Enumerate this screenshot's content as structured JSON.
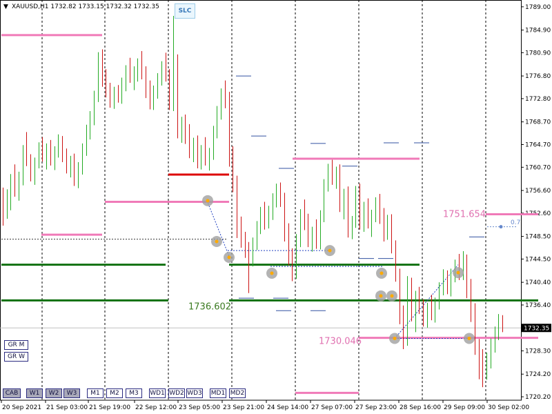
{
  "header": {
    "symbol": "XAUUSD,H1",
    "open": "1732.82",
    "high": "1733.15",
    "low": "1732.32",
    "close": "1732.35",
    "arrow_icon": "triangle-down-icon"
  },
  "slc_button": {
    "label": "SLC"
  },
  "left_buttons": [
    {
      "id": "grm",
      "label": "GR M"
    },
    {
      "id": "grw",
      "label": "GR W"
    }
  ],
  "bottom_buttons": [
    {
      "label": "CAB",
      "dark": true
    },
    {
      "label": "W1",
      "dark": true
    },
    {
      "label": "W2",
      "dark": true
    },
    {
      "label": "W3",
      "dark": true
    },
    {
      "label": "M1",
      "dark": false
    },
    {
      "label": "M2",
      "dark": false
    },
    {
      "label": "M3",
      "dark": false
    },
    {
      "label": "WD1",
      "dark": false
    },
    {
      "label": "WD2",
      "dark": false
    },
    {
      "label": "WD3",
      "dark": false
    },
    {
      "label": "MD1",
      "dark": false
    },
    {
      "label": "MD2",
      "dark": false
    }
  ],
  "chart_data": {
    "type": "candlestick",
    "symbol": "XAUUSD",
    "timeframe": "H1",
    "price_axis": {
      "ticks": [
        "1789.00",
        "1784.90",
        "1780.90",
        "1776.80",
        "1772.80",
        "1768.70",
        "1764.70",
        "1760.70",
        "1756.60",
        "1752.60",
        "1748.50",
        "1744.50",
        "1740.40",
        "1736.40",
        "1732.35",
        "1728.30",
        "1724.20",
        "1720.20"
      ],
      "range": [
        1719.6,
        1790.2
      ],
      "current_price": "1732.35"
    },
    "time_axis": {
      "labels": [
        "20 Sep 2021",
        "21 Sep 03:00",
        "21 Sep 19:00",
        "22 Sep 12:00",
        "23 Sep 05:00",
        "23 Sep 21:00",
        "24 Sep 14:00",
        "27 Sep 07:00",
        "27 Sep 23:00",
        "28 Sep 16:00",
        "29 Sep 09:00",
        "30 Sep 02:00"
      ]
    },
    "annotations": [
      {
        "text": "1736.602",
        "color": "#3a7a20"
      },
      {
        "text": "1730.046",
        "color": "#e070b0"
      },
      {
        "text": "1751.654",
        "color": "#e070b0"
      },
      {
        "text": "0.7",
        "color": "#6688cc"
      }
    ],
    "candles": [
      [
        1755.2,
        1757.1,
        1750.4,
        1752.9
      ],
      [
        1752.9,
        1756.8,
        1751.6,
        1754.2
      ],
      [
        1754.2,
        1759.5,
        1753.1,
        1758.7
      ],
      [
        1758.7,
        1761.2,
        1755.5,
        1756.1
      ],
      [
        1756.1,
        1759.9,
        1754.8,
        1759.3
      ],
      [
        1759.3,
        1764.6,
        1757.5,
        1763.8
      ],
      [
        1763.8,
        1766.9,
        1760.9,
        1761.4
      ],
      [
        1761.4,
        1763.0,
        1758.2,
        1759.0
      ],
      [
        1759.0,
        1762.4,
        1757.6,
        1761.8
      ],
      [
        1761.8,
        1765.1,
        1760.5,
        1764.3
      ],
      [
        1764.3,
        1766.0,
        1761.7,
        1762.5
      ],
      [
        1762.5,
        1764.9,
        1760.3,
        1763.9
      ],
      [
        1763.9,
        1765.5,
        1761.0,
        1762.0
      ],
      [
        1762.0,
        1764.4,
        1760.2,
        1763.6
      ],
      [
        1763.6,
        1766.5,
        1762.4,
        1765.4
      ],
      [
        1765.4,
        1766.2,
        1761.6,
        1762.8
      ],
      [
        1762.8,
        1764.0,
        1759.6,
        1760.5
      ],
      [
        1760.5,
        1762.7,
        1758.9,
        1761.9
      ],
      [
        1761.9,
        1763.1,
        1757.4,
        1758.3
      ],
      [
        1758.3,
        1761.6,
        1757.0,
        1760.8
      ],
      [
        1760.8,
        1764.9,
        1759.4,
        1764.1
      ],
      [
        1764.1,
        1768.2,
        1762.7,
        1767.3
      ],
      [
        1767.3,
        1770.6,
        1765.6,
        1769.4
      ],
      [
        1769.4,
        1774.2,
        1768.1,
        1773.5
      ],
      [
        1773.5,
        1781.0,
        1772.2,
        1779.8
      ],
      [
        1779.8,
        1781.5,
        1774.9,
        1776.2
      ],
      [
        1776.2,
        1778.0,
        1773.0,
        1774.1
      ],
      [
        1774.1,
        1775.6,
        1771.2,
        1772.4
      ],
      [
        1772.4,
        1774.9,
        1771.0,
        1773.8
      ],
      [
        1773.8,
        1775.2,
        1772.1,
        1772.9
      ],
      [
        1772.9,
        1776.5,
        1771.9,
        1775.7
      ],
      [
        1775.7,
        1778.7,
        1774.1,
        1777.9
      ],
      [
        1777.9,
        1780.0,
        1775.6,
        1776.4
      ],
      [
        1776.4,
        1778.5,
        1774.3,
        1777.6
      ],
      [
        1777.6,
        1779.9,
        1775.8,
        1778.8
      ],
      [
        1778.8,
        1781.2,
        1776.2,
        1777.1
      ],
      [
        1777.1,
        1778.5,
        1772.9,
        1773.9
      ],
      [
        1773.9,
        1776.0,
        1770.9,
        1771.7
      ],
      [
        1771.7,
        1775.1,
        1770.8,
        1774.3
      ],
      [
        1774.3,
        1777.3,
        1772.8,
        1776.5
      ],
      [
        1776.5,
        1779.4,
        1775.1,
        1778.6
      ],
      [
        1778.6,
        1780.9,
        1775.8,
        1776.8
      ],
      [
        1776.8,
        1778.0,
        1770.8,
        1772.0
      ],
      [
        1772.0,
        1787.4,
        1770.6,
        1779.6
      ],
      [
        1779.6,
        1780.6,
        1765.8,
        1767.2
      ],
      [
        1767.2,
        1769.6,
        1765.0,
        1768.7
      ],
      [
        1768.7,
        1770.0,
        1764.8,
        1766.1
      ],
      [
        1766.1,
        1768.3,
        1762.3,
        1763.4
      ],
      [
        1763.4,
        1765.9,
        1761.6,
        1764.9
      ],
      [
        1764.9,
        1766.3,
        1760.5,
        1761.4
      ],
      [
        1761.4,
        1764.6,
        1760.3,
        1763.9
      ],
      [
        1763.9,
        1766.0,
        1761.0,
        1762.2
      ],
      [
        1762.2,
        1764.1,
        1760.1,
        1763.2
      ],
      [
        1763.2,
        1768.0,
        1762.0,
        1767.1
      ],
      [
        1767.1,
        1771.5,
        1765.8,
        1770.4
      ],
      [
        1770.4,
        1774.6,
        1769.1,
        1773.6
      ],
      [
        1773.6,
        1776.0,
        1771.1,
        1772.4
      ],
      [
        1772.4,
        1774.0,
        1760.8,
        1762.1
      ],
      [
        1762.1,
        1764.4,
        1756.3,
        1757.5
      ],
      [
        1757.5,
        1759.2,
        1748.2,
        1750.1
      ],
      [
        1750.1,
        1752.0,
        1746.5,
        1747.6
      ],
      [
        1747.6,
        1749.3,
        1744.7,
        1746.0
      ],
      [
        1746.0,
        1747.5,
        1738.5,
        1744.6
      ],
      [
        1744.6,
        1748.3,
        1743.2,
        1747.4
      ],
      [
        1747.4,
        1751.2,
        1746.1,
        1750.3
      ],
      [
        1750.3,
        1753.7,
        1748.9,
        1752.8
      ],
      [
        1752.8,
        1754.6,
        1749.7,
        1750.9
      ],
      [
        1750.9,
        1753.9,
        1749.9,
        1752.9
      ],
      [
        1752.9,
        1756.1,
        1751.4,
        1755.2
      ],
      [
        1755.2,
        1757.8,
        1753.6,
        1756.9
      ],
      [
        1756.9,
        1758.0,
        1753.7,
        1754.6
      ],
      [
        1754.6,
        1756.2,
        1747.6,
        1748.8
      ],
      [
        1748.8,
        1750.8,
        1743.4,
        1744.6
      ],
      [
        1744.6,
        1746.4,
        1740.6,
        1742.1
      ],
      [
        1742.1,
        1748.9,
        1741.0,
        1747.9
      ],
      [
        1747.9,
        1753.3,
        1746.6,
        1752.3
      ],
      [
        1752.3,
        1755.0,
        1749.6,
        1750.9
      ],
      [
        1750.9,
        1752.5,
        1746.6,
        1747.7
      ],
      [
        1747.7,
        1750.2,
        1745.8,
        1749.1
      ],
      [
        1749.1,
        1751.5,
        1746.3,
        1747.0
      ],
      [
        1747.0,
        1753.1,
        1746.2,
        1752.2
      ],
      [
        1752.2,
        1758.6,
        1751.0,
        1757.7
      ],
      [
        1757.7,
        1761.3,
        1756.4,
        1760.5
      ],
      [
        1760.5,
        1762.0,
        1757.6,
        1758.5
      ],
      [
        1758.5,
        1760.8,
        1756.9,
        1759.9
      ],
      [
        1759.9,
        1761.2,
        1752.8,
        1753.7
      ],
      [
        1753.7,
        1756.9,
        1751.5,
        1755.6
      ],
      [
        1755.6,
        1757.3,
        1748.3,
        1749.4
      ],
      [
        1749.4,
        1752.1,
        1748.0,
        1751.1
      ],
      [
        1751.1,
        1757.4,
        1750.0,
        1756.5
      ],
      [
        1756.5,
        1757.8,
        1749.7,
        1750.8
      ],
      [
        1750.8,
        1754.6,
        1749.3,
        1753.7
      ],
      [
        1753.7,
        1755.2,
        1749.9,
        1750.9
      ],
      [
        1750.9,
        1753.2,
        1748.4,
        1752.2
      ],
      [
        1752.2,
        1755.4,
        1751.0,
        1754.5
      ],
      [
        1754.5,
        1756.0,
        1750.7,
        1751.8
      ],
      [
        1751.8,
        1753.5,
        1747.6,
        1748.9
      ],
      [
        1748.9,
        1752.3,
        1747.9,
        1751.3
      ],
      [
        1751.3,
        1752.4,
        1745.5,
        1746.8
      ],
      [
        1746.8,
        1747.8,
        1740.5,
        1741.9
      ],
      [
        1741.9,
        1742.8,
        1733.0,
        1734.6
      ],
      [
        1734.6,
        1736.3,
        1728.6,
        1730.5
      ],
      [
        1730.5,
        1741.5,
        1729.2,
        1739.8
      ],
      [
        1739.8,
        1741.2,
        1733.5,
        1735.1
      ],
      [
        1735.1,
        1738.9,
        1731.6,
        1737.6
      ],
      [
        1737.6,
        1739.6,
        1734.8,
        1735.9
      ],
      [
        1735.9,
        1737.4,
        1732.6,
        1733.8
      ],
      [
        1733.8,
        1736.8,
        1732.4,
        1735.7
      ],
      [
        1735.7,
        1738.2,
        1733.7,
        1734.5
      ],
      [
        1734.5,
        1737.7,
        1733.3,
        1736.8
      ],
      [
        1736.8,
        1740.4,
        1735.6,
        1739.5
      ],
      [
        1739.5,
        1742.7,
        1738.1,
        1741.6
      ],
      [
        1741.6,
        1742.5,
        1738.3,
        1739.2
      ],
      [
        1739.2,
        1742.8,
        1737.9,
        1741.9
      ],
      [
        1741.9,
        1744.4,
        1740.4,
        1743.3
      ],
      [
        1743.3,
        1745.4,
        1740.8,
        1742.1
      ],
      [
        1742.1,
        1745.9,
        1740.8,
        1744.6
      ],
      [
        1744.6,
        1745.3,
        1737.6,
        1738.8
      ],
      [
        1738.8,
        1741.0,
        1733.4,
        1734.6
      ],
      [
        1734.6,
        1736.7,
        1727.6,
        1728.8
      ],
      [
        1728.8,
        1730.4,
        1723.3,
        1726.2
      ],
      [
        1726.2,
        1728.6,
        1721.9,
        1724.6
      ],
      [
        1724.6,
        1728.0,
        1723.2,
        1726.9
      ],
      [
        1726.9,
        1730.5,
        1725.2,
        1729.3
      ],
      [
        1729.3,
        1732.6,
        1728.0,
        1731.4
      ],
      [
        1731.4,
        1734.8,
        1730.2,
        1733.9
      ],
      [
        1733.9,
        1734.6,
        1731.6,
        1732.35
      ]
    ]
  }
}
